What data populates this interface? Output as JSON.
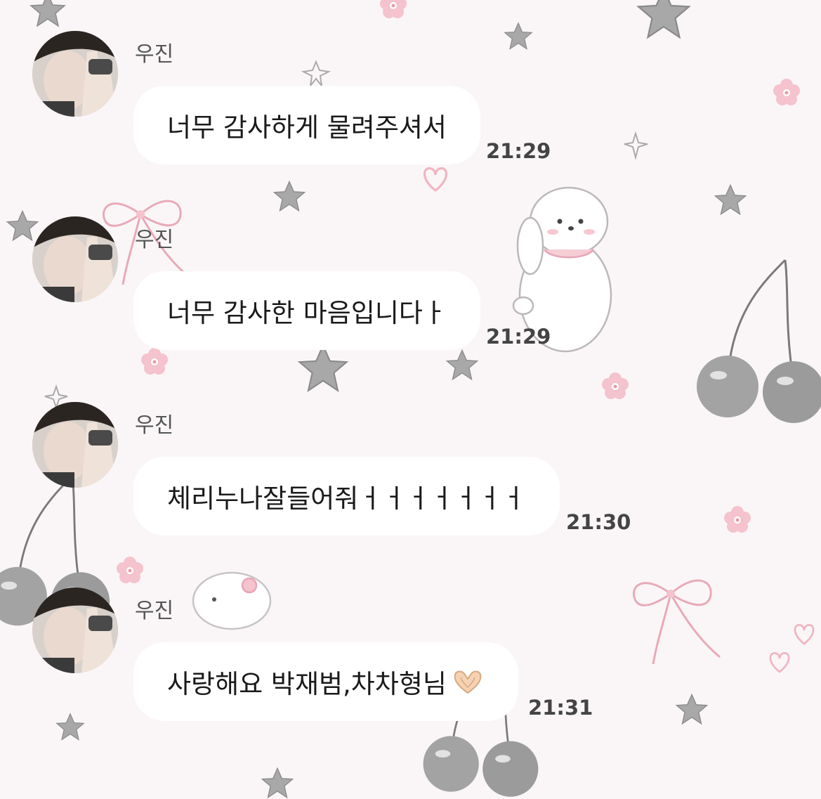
{
  "chat": {
    "messages": [
      {
        "sender": "우진",
        "text": "너무 감사하게 물려주셔서",
        "time": "21:29"
      },
      {
        "sender": "우진",
        "text": "너무 감사한 마음입니다ㅏ",
        "time": "21:29"
      },
      {
        "sender": "우진",
        "text": "체리누나잘들어줘ㅓㅓㅓㅓㅓㅓㅓ",
        "time": "21:30"
      },
      {
        "sender": "우진",
        "text": "사랑해요 박재범,차차형님",
        "emoji": "heart-hands",
        "time": "21:31"
      }
    ]
  },
  "colors": {
    "background": "#faf6f7",
    "bubble": "#ffffff",
    "time_text": "#444444",
    "wallpaper_pink": "#f1c4cf",
    "wallpaper_gray": "#9a9a9a"
  },
  "icons": [
    "avatar",
    "heart-hands-emoji",
    "star-icon",
    "flower-icon",
    "cherry-icon",
    "ribbon-icon",
    "puppy-illustration",
    "heart-icon"
  ]
}
